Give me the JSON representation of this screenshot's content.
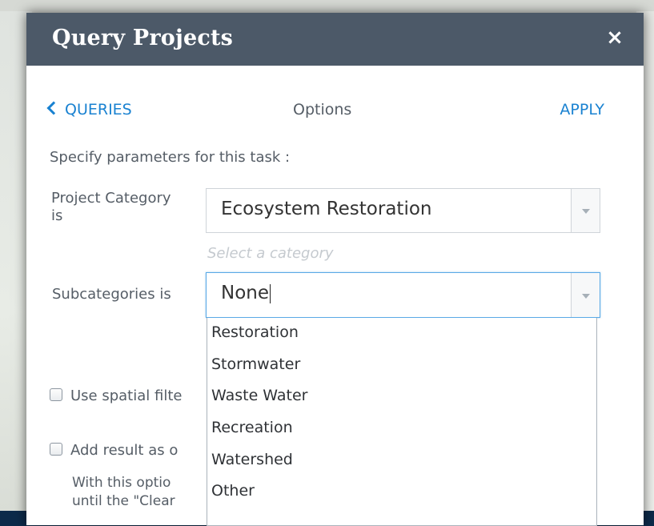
{
  "dialog": {
    "title": "Query Projects",
    "close_glyph": "×"
  },
  "nav": {
    "back_label": "QUERIES",
    "center_label": "Options",
    "apply_label": "APPLY"
  },
  "instructions": "Specify parameters for this task :",
  "fields": {
    "project_category": {
      "label_line1": "Project Category",
      "label_line2": "is",
      "value": "Ecosystem Restoration",
      "hint": "Select a category"
    },
    "subcategories": {
      "label": "Subcategories is",
      "value": "None",
      "options": [
        "Restoration",
        "Stormwater",
        "Waste Water",
        "Recreation",
        "Watershed",
        "Other"
      ]
    }
  },
  "checkboxes": {
    "spatial_filter_label": "Use spatial filte",
    "add_result_label": "Add result as o",
    "note_line1": "With this optio",
    "note_line2": "until the \"Clear"
  },
  "icons": {
    "close": "close-icon",
    "back": "chevron-left-icon",
    "dropdown": "chevron-down-icon"
  },
  "colors": {
    "title_bar": "#4c5968",
    "link": "#1a82d1",
    "focus_border": "#5aa9e6"
  }
}
